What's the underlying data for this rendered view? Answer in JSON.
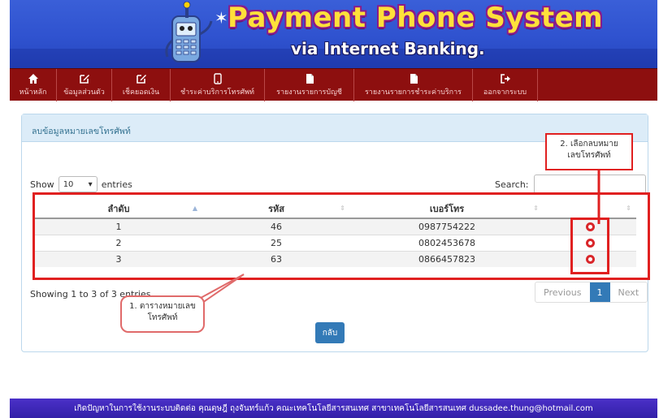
{
  "banner": {
    "title": "Payment Phone System",
    "subtitle": "via Internet Banking."
  },
  "nav": {
    "items": [
      {
        "label": "หน้าหลัก",
        "icon": "home-icon"
      },
      {
        "label": "ข้อมูลส่วนตัว",
        "icon": "edit-icon"
      },
      {
        "label": "เช็คยอดเงิน",
        "icon": "edit-icon"
      },
      {
        "label": "ชำระค่าบริการโทรศัพท์",
        "icon": "phone-icon"
      },
      {
        "label": "รายงานรายการบัญชี",
        "icon": "document-icon"
      },
      {
        "label": "รายงานรายการชำระค่าบริการ",
        "icon": "document-icon"
      },
      {
        "label": "ออกจากระบบ",
        "icon": "logout-icon"
      }
    ]
  },
  "panel": {
    "heading": "ลบข้อมูลหมายเลขโทรศัพท์"
  },
  "length": {
    "show": "Show",
    "value": "10",
    "entries": "entries"
  },
  "search": {
    "label": "Search:"
  },
  "table": {
    "columns": [
      "ลำดับ",
      "รหัส",
      "เบอร์โทร",
      ""
    ],
    "rows": [
      [
        "1",
        "46",
        "0987754222"
      ],
      [
        "2",
        "25",
        "0802453678"
      ],
      [
        "3",
        "63",
        "0866457823"
      ]
    ]
  },
  "info": "Showing 1 to 3 of 3 entries",
  "pager": {
    "previous": "Previous",
    "current": "1",
    "next": "Next"
  },
  "back_button": "กลับ",
  "annotations": {
    "callout1_line1": "1. ตารางหมายเลข",
    "callout1_line2": "โทรศัพท์",
    "callout2_line1": "2. เลือกลบหมาย",
    "callout2_line2": "เลขโทรศัพท์"
  },
  "footer": "เกิดปัญหาในการใช้งานระบบติดต่อ คุณดุษฎี ถุงจันทร์แก้ว คณะเทคโนโลยีสารสนเทศ สาขาเทคโนโลยีสารสนเทศ dussadee.thung@hotmail.com",
  "colors": {
    "banner": "#2f52cf",
    "nav": "#8d0f0f",
    "primary": "#337ab7",
    "annotation": "#e02020",
    "delete": "#d9262a"
  }
}
